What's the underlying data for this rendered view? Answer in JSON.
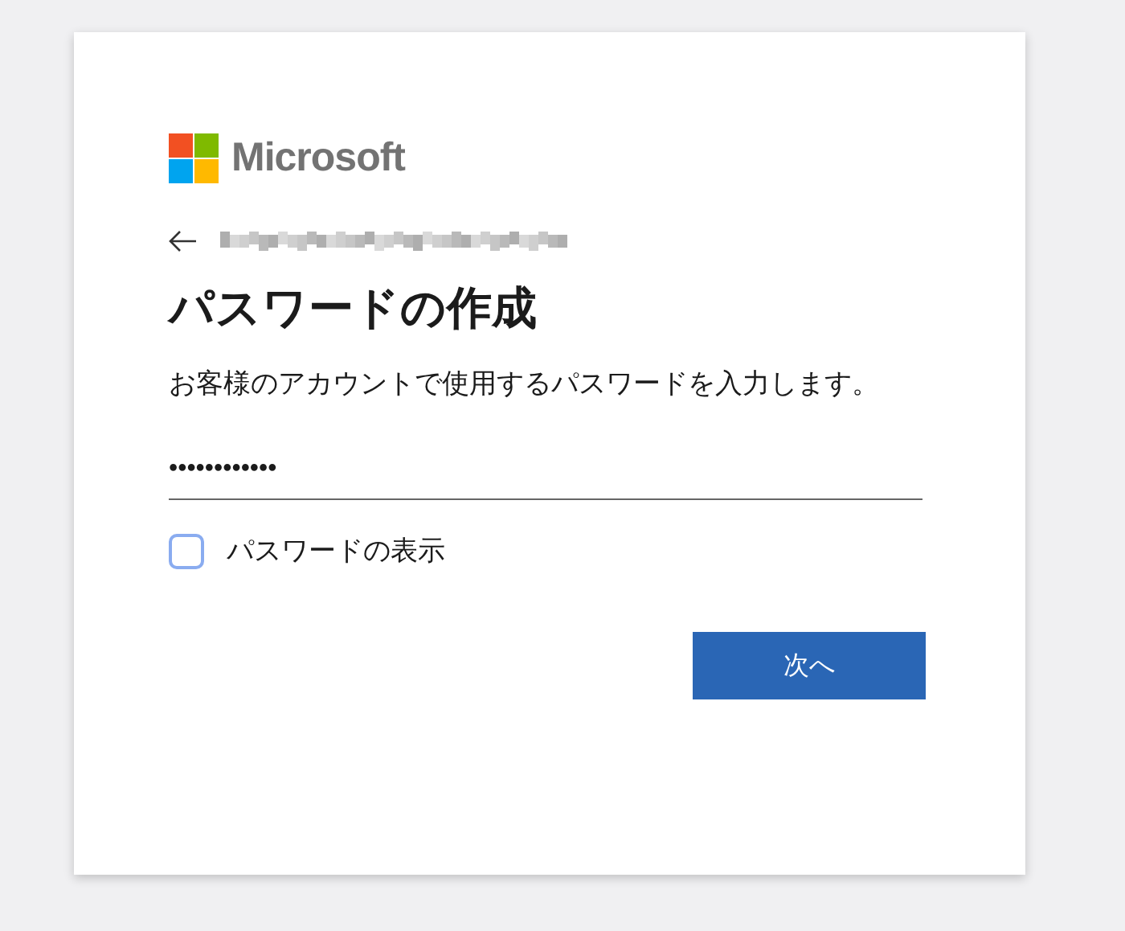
{
  "brand": {
    "name": "Microsoft"
  },
  "title": "パスワードの作成",
  "description": "お客様のアカウントで使用するパスワードを入力します。",
  "password": {
    "value": "••••••••••••"
  },
  "show_password": {
    "label": "パスワードの表示",
    "checked": false
  },
  "next_button": {
    "label": "次へ"
  }
}
